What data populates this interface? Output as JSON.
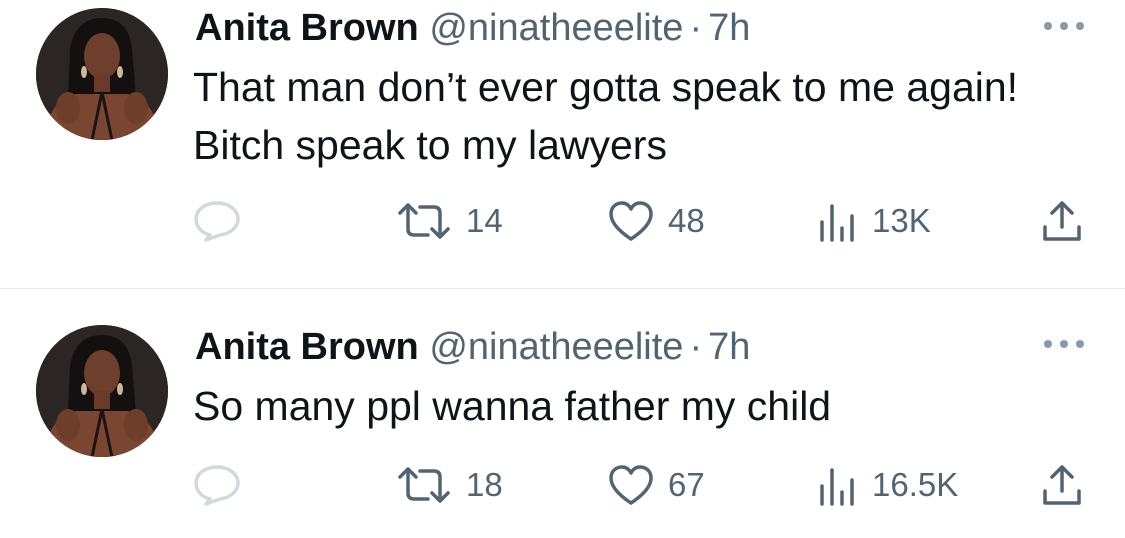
{
  "tweets": [
    {
      "author_name": "Anita Brown",
      "handle": "@ninatheeelite",
      "separator": "·",
      "time": "7h",
      "text": "That man don’t ever gotta speak to me again! Bitch speak to my lawyers",
      "retweets": "14",
      "likes": "48",
      "views": "13K"
    },
    {
      "author_name": "Anita Brown",
      "handle": "@ninatheeelite",
      "separator": "·",
      "time": "7h",
      "text": "So many ppl wanna father my child",
      "retweets": "18",
      "likes": "67",
      "views": "16.5K"
    }
  ],
  "icons": {
    "more": "more-options-icon",
    "reply": "reply-icon",
    "retweet": "retweet-icon",
    "like": "heart-icon",
    "views": "views-icon",
    "share": "share-icon"
  },
  "colors": {
    "text": "#0f1419",
    "secondary": "#536471",
    "divider": "#e1e6ea"
  }
}
